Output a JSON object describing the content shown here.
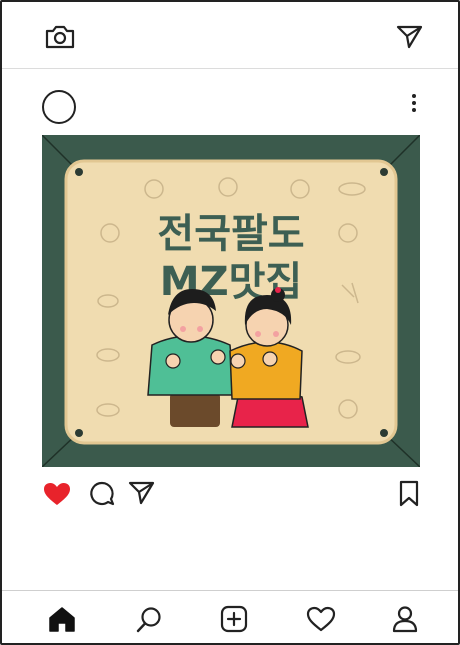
{
  "topbar": {
    "left_icon": "camera-icon",
    "right_icon": "send-icon"
  },
  "post": {
    "menu_icon": "more-vertical-icon",
    "image": {
      "title_line1": "전국팔도",
      "title_line2": "MZ맛집",
      "colors": {
        "border": "#3b5a4c",
        "paper": "#f2dfb6",
        "title": "#3d5f53"
      }
    },
    "actions": {
      "like_icon": "heart-filled-icon",
      "comment_icon": "comment-icon",
      "share_icon": "send-icon",
      "save_icon": "bookmark-icon",
      "like_color": "#e8232b"
    }
  },
  "bottom_nav": {
    "items": [
      "home-icon",
      "search-icon",
      "add-post-icon",
      "heart-icon",
      "profile-icon"
    ]
  }
}
